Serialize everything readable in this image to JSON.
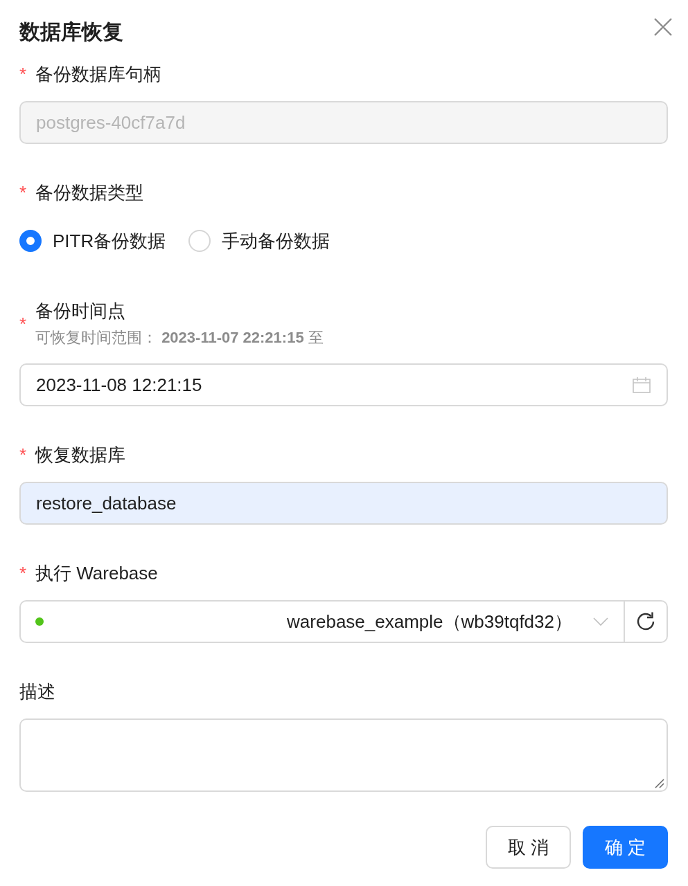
{
  "dialog": {
    "title": "数据库恢复"
  },
  "fields": [
    {
      "kind": "input",
      "required_mark": "*",
      "label": "备份数据库句柄",
      "value": "postgres-40cf7a7d",
      "disabled": true,
      "autofilled": false
    },
    {
      "kind": "radio",
      "required_mark": "*",
      "label": "备份数据类型",
      "options": [
        {
          "label": "PITR备份数据",
          "selected": true
        },
        {
          "label": "手动备份数据",
          "selected": false
        }
      ]
    },
    {
      "kind": "date",
      "required_mark": "*",
      "label": "备份时间点",
      "hint": "可恢复时间范围： **2023-11-07 22:21:15** 至",
      "value": "2023-11-08 12:21:15"
    },
    {
      "kind": "input",
      "required_mark": "*",
      "label": "恢复数据库",
      "value": "restore_database",
      "disabled": false,
      "autofilled": true
    },
    {
      "kind": "select",
      "required_mark": "*",
      "label": "执行 Warebase",
      "value": "warebase_example（wb39tqfd32）",
      "color": "#52c41a"
    },
    {
      "kind": "textarea",
      "label": "描述"
    }
  ],
  "buttons": [
    {
      "label": "取 消",
      "kind": "default"
    },
    {
      "label": "确 定",
      "kind": "primary"
    }
  ]
}
